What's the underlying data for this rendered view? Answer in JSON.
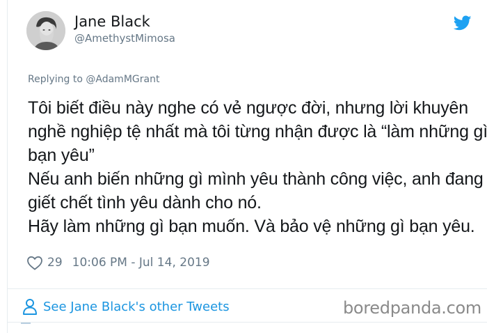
{
  "author": {
    "name": "Jane Black",
    "handle": "@AmethystMimosa"
  },
  "replying_to": "Replying to @AdamMGrant",
  "tweet_lines": [
    "Tôi biết điều này nghe có vẻ ngược đời, nhưng lời khuyên",
    "nghề nghiệp tệ nhất mà tôi từng nhận được là “làm những gì",
    "bạn yêu”",
    "Nếu anh biến những gì mình yêu thành công việc, anh đang",
    "giết chết tình yêu dành cho nó.",
    "Hãy làm những gì bạn muốn. Và bảo vệ những gì bạn yêu."
  ],
  "meta": {
    "likes": "29",
    "timestamp": "10:06 PM - Jul 14, 2019"
  },
  "see_more_label": "See Jane Black's other Tweets",
  "watermark": "boredpanda.com",
  "colors": {
    "accent": "#1b95e0",
    "twitter_blue": "#1da1f2",
    "muted": "#657786"
  }
}
